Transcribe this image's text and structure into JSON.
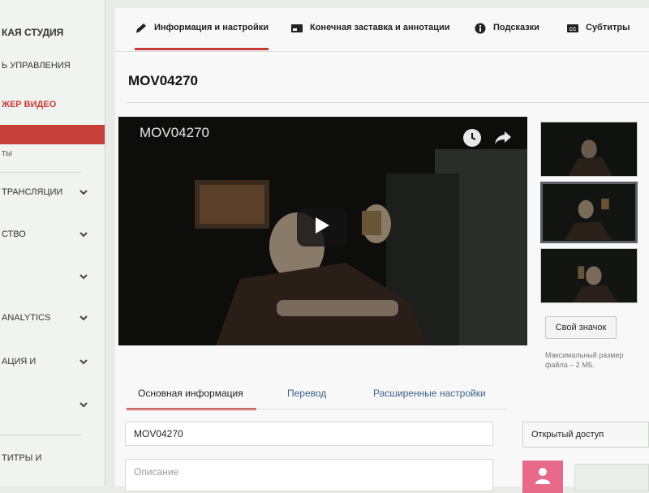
{
  "sidebar": {
    "items": [
      {
        "label": "КАЯ СТУДИЯ"
      },
      {
        "label": "Ь УПРАВЛЕНИЯ"
      },
      {
        "label": "ЖЕР ВИДЕО"
      },
      {
        "label": ""
      },
      {
        "label": "ты"
      },
      {
        "label": "ТРАНСЛЯЦИИ"
      },
      {
        "label": "СТВО"
      },
      {
        "label": ""
      },
      {
        "label": "ANALYTICS"
      },
      {
        "label": "АЦИЯ И"
      },
      {
        "label": ""
      },
      {
        "label": "ТИТРЫ И"
      }
    ]
  },
  "topnav": {
    "tabs": [
      {
        "label": "Информация и настройки",
        "icon": "pencil-icon"
      },
      {
        "label": "Конечная заставка и аннотации",
        "icon": "end-screen-icon"
      },
      {
        "label": "Подсказки",
        "icon": "info-icon"
      },
      {
        "label": "Субтитры",
        "icon": "cc-icon"
      }
    ]
  },
  "video": {
    "title": "MOV04270",
    "player_title": "MOV04270"
  },
  "thumbnails": {
    "button_label": "Свой значок",
    "note": "Максимальный размер файла – 2 МБ."
  },
  "subtabs": [
    {
      "label": "Основная информация"
    },
    {
      "label": "Перевод"
    },
    {
      "label": "Расширенные настройки"
    }
  ],
  "form": {
    "title_value": "MOV04270",
    "description_placeholder": "Описание",
    "visibility": "Открытый доступ"
  },
  "colors": {
    "accent": "#c83a35",
    "link": "#3c5f8a",
    "avatar": "#e86a8a"
  }
}
